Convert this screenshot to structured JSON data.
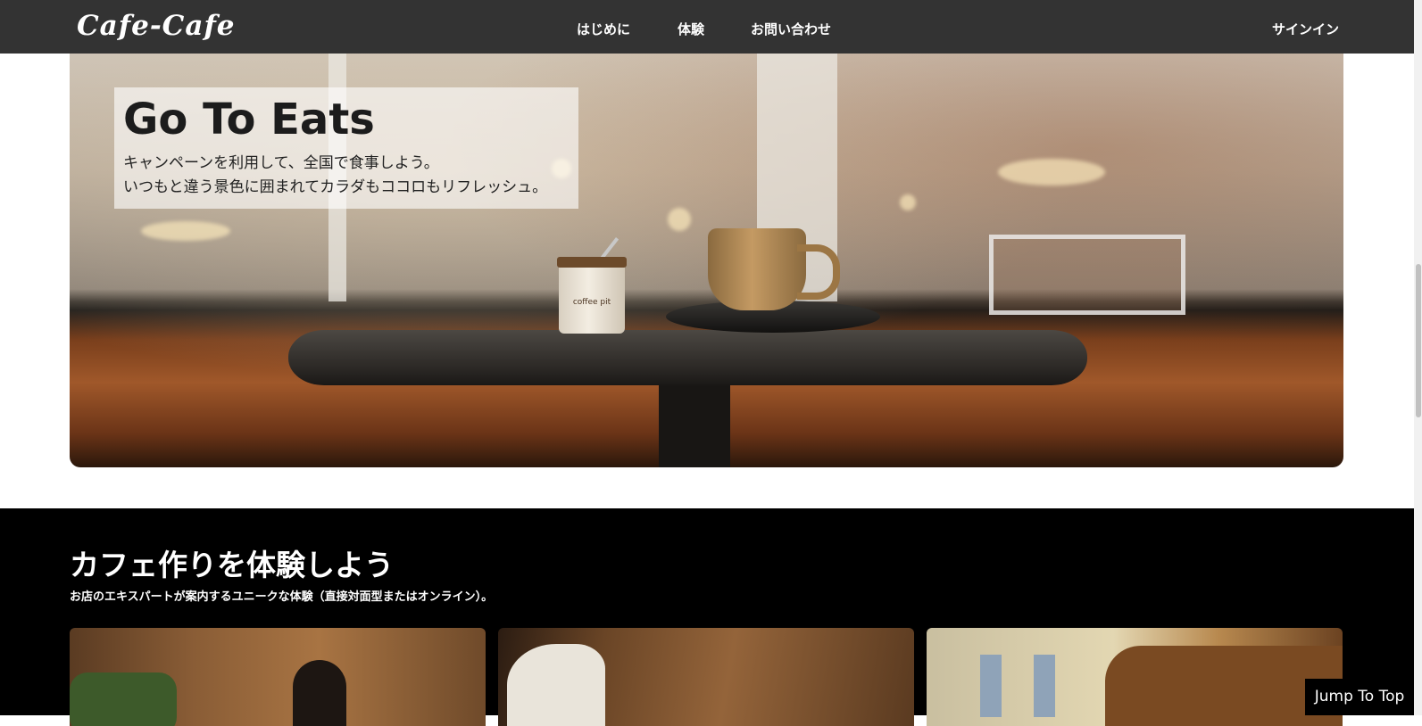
{
  "header": {
    "logo": "Cafe-Cafe",
    "nav": [
      "はじめに",
      "体験",
      "お問い合わせ"
    ],
    "signin": "サインイン"
  },
  "hero": {
    "title": "Go To Eats",
    "lines": [
      "キャンペーンを利用して、全国で食事しよう。",
      "いつもと違う景色に囲まれてカラダもココロもリフレッシュ。"
    ],
    "jar_label": "coffee pit"
  },
  "experience": {
    "title": "カフェ作りを体験しよう",
    "subtitle": "お店のエキスパートが案内するユニークな体験（直接対面型またはオンライン）。"
  },
  "jump_to_top": "Jump To Top",
  "colors": {
    "header_bg": "#333333",
    "section_bg": "#000000",
    "text_light": "#ffffff"
  }
}
